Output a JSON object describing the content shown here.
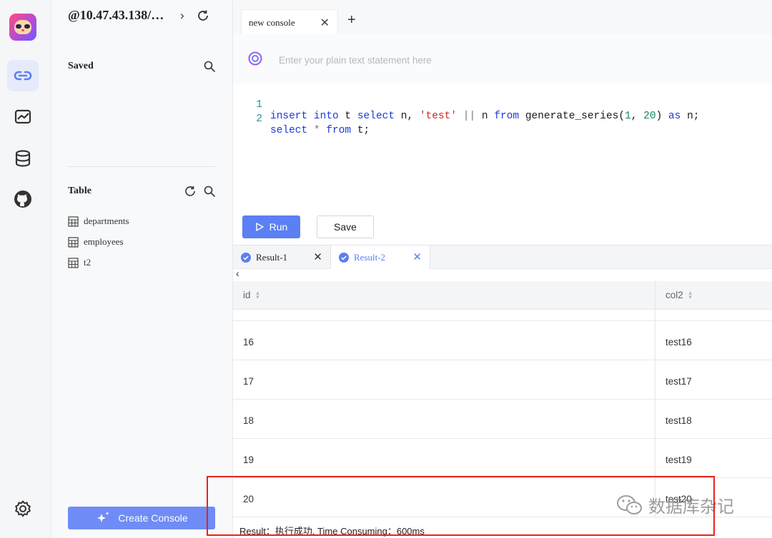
{
  "rail": {
    "items": [
      {
        "icon": "link-icon",
        "active": true
      },
      {
        "icon": "chart-icon",
        "active": false
      },
      {
        "icon": "database-icon",
        "active": false
      },
      {
        "icon": "github-icon",
        "active": false
      }
    ],
    "bottom_icon": "gear-icon"
  },
  "sidebar": {
    "connection_title": "@10.47.43.138/…",
    "saved_title": "Saved",
    "table_title": "Table",
    "tables": [
      "departments",
      "employees",
      "t2"
    ],
    "create_console_label": "Create Console"
  },
  "console": {
    "tab_label": "new console",
    "ai_placeholder": "Enter your plain text statement here",
    "line_numbers": [
      "1",
      "2"
    ],
    "run_label": "Run",
    "save_label": "Save"
  },
  "results": {
    "tabs": [
      {
        "label": "Result-1",
        "active": false
      },
      {
        "label": "Result-2",
        "active": true
      }
    ],
    "columns": [
      "id",
      "col2"
    ],
    "rows": [
      [
        "16",
        "test16"
      ],
      [
        "17",
        "test17"
      ],
      [
        "18",
        "test18"
      ],
      [
        "19",
        "test19"
      ],
      [
        "20",
        "test20"
      ]
    ],
    "status": "Result：执行成功. Time Consuming：600ms"
  },
  "watermark": {
    "text": "数据库杂记"
  },
  "colors": {
    "accent": "#5b7ff4",
    "highlight": "#e8231f"
  }
}
